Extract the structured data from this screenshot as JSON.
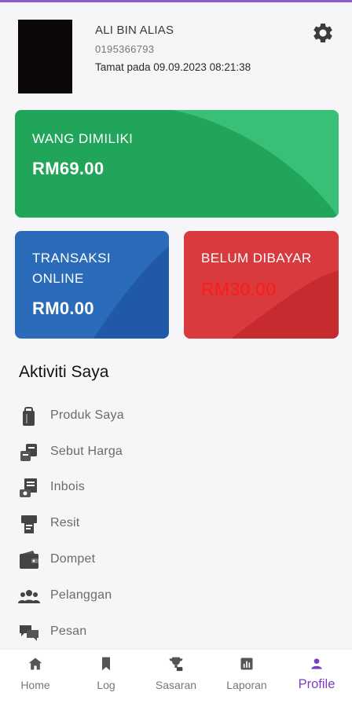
{
  "profile": {
    "name": "ALI BIN ALIAS",
    "phone": "0195366793",
    "expiry": "Tamat pada 09.09.2023 08:21:38"
  },
  "cards": {
    "balance": {
      "label": "WANG DIMILIKI",
      "amount": "RM69.00",
      "color": "#21a55a"
    },
    "online": {
      "label": "TRANSAKSI ONLINE",
      "amount": "RM0.00",
      "color": "#2a6cba"
    },
    "unpaid": {
      "label": "BELUM DIBAYAR",
      "amount": "RM30.00",
      "color": "#d93a3d",
      "amount_color": "#ff1a1a"
    }
  },
  "activity": {
    "title": "Aktiviti Saya",
    "items": [
      {
        "label": "Produk Saya",
        "icon": "product-bag-icon"
      },
      {
        "label": "Sebut Harga",
        "icon": "quotation-icon"
      },
      {
        "label": "Inbois",
        "icon": "invoice-icon"
      },
      {
        "label": "Resit",
        "icon": "receipt-icon"
      },
      {
        "label": "Dompet",
        "icon": "wallet-icon"
      },
      {
        "label": "Pelanggan",
        "icon": "customers-icon"
      },
      {
        "label": "Pesan",
        "icon": "message-icon"
      }
    ]
  },
  "nav": {
    "items": [
      {
        "label": "Home",
        "icon": "home-icon"
      },
      {
        "label": "Log",
        "icon": "bookmark-icon"
      },
      {
        "label": "Sasaran",
        "icon": "trophy-icon"
      },
      {
        "label": "Laporan",
        "icon": "report-icon"
      },
      {
        "label": "Profile",
        "icon": "person-icon",
        "active": true
      }
    ],
    "active_color": "#7b3fbf"
  }
}
